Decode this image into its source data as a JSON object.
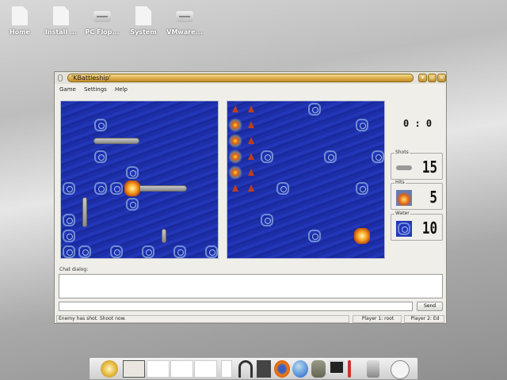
{
  "desktop": {
    "icons": [
      {
        "label": "Home",
        "type": "file"
      },
      {
        "label": "Install ...",
        "type": "file"
      },
      {
        "label": "PC Flop...",
        "type": "drive"
      },
      {
        "label": "System",
        "type": "file"
      },
      {
        "label": "VMware...",
        "type": "drive"
      }
    ]
  },
  "window": {
    "title": "'KBattleship'",
    "menu": [
      "Game",
      "Settings",
      "Help"
    ],
    "buttons": [
      "minimize",
      "maximize",
      "close"
    ]
  },
  "own_board": {
    "grid": [
      10,
      10
    ],
    "water": [
      [
        2,
        1
      ],
      [
        2,
        3
      ],
      [
        4,
        4
      ],
      [
        0,
        5
      ],
      [
        2,
        5
      ],
      [
        3,
        5
      ],
      [
        4,
        6
      ],
      [
        0,
        7
      ],
      [
        0,
        8
      ],
      [
        0,
        9
      ],
      [
        1,
        9
      ],
      [
        3,
        9
      ],
      [
        5,
        9
      ],
      [
        7,
        9
      ],
      [
        9,
        9
      ]
    ],
    "ships": [
      {
        "col": 2,
        "row": 2,
        "length": 3,
        "orientation": "horizontal"
      },
      {
        "col": 4,
        "row": 5,
        "length": 4,
        "orientation": "horizontal"
      },
      {
        "col": 1,
        "row": 6,
        "length": 2,
        "orientation": "vertical"
      },
      {
        "col": 6,
        "row": 8,
        "length": 1,
        "orientation": "vertical"
      }
    ],
    "hits": [
      [
        4,
        5
      ]
    ]
  },
  "enemy_board": {
    "grid": [
      10,
      10
    ],
    "water": [
      [
        5,
        0
      ],
      [
        8,
        1
      ],
      [
        2,
        3
      ],
      [
        6,
        3
      ],
      [
        9,
        3
      ],
      [
        3,
        5
      ],
      [
        8,
        5
      ],
      [
        2,
        7
      ],
      [
        5,
        8
      ]
    ],
    "hits": [
      [
        8,
        8
      ]
    ],
    "sunk": [
      [
        0,
        1
      ],
      [
        0,
        2
      ],
      [
        0,
        3
      ],
      [
        0,
        4
      ]
    ],
    "sunk_border": [
      [
        0,
        0
      ],
      [
        1,
        0
      ],
      [
        1,
        1
      ],
      [
        1,
        2
      ],
      [
        1,
        3
      ],
      [
        1,
        4
      ],
      [
        0,
        5
      ],
      [
        1,
        5
      ]
    ]
  },
  "score": "0 : 0",
  "stats": [
    {
      "label": "Shots",
      "value": "15",
      "icon": "ship-icon"
    },
    {
      "label": "Hits",
      "value": "5",
      "icon": "explosion-icon"
    },
    {
      "label": "Water",
      "value": "10",
      "icon": "water-icon"
    }
  ],
  "chat": {
    "label": "Chat dialog:",
    "log": "",
    "input": "",
    "send_label": "Send"
  },
  "status": {
    "message": "Enemy has shot. Shoot now.",
    "player1": "Player 1: root",
    "player2": "Player 2: Ed"
  },
  "colors": {
    "sea": "#1d2fa8",
    "title_bar": "#d9a847"
  }
}
